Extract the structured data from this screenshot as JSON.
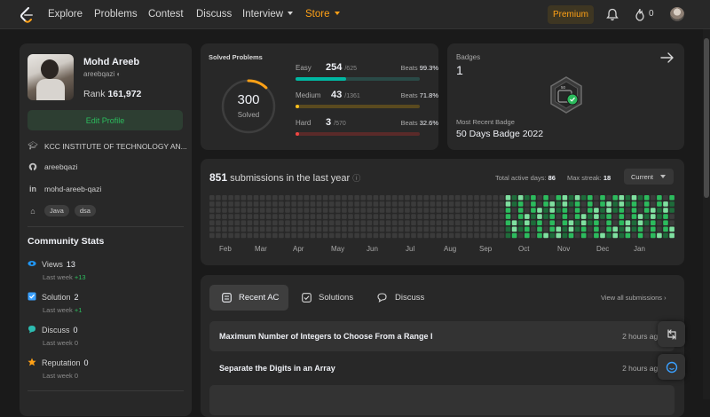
{
  "nav": {
    "items": [
      "Explore",
      "Problems",
      "Contest",
      "Discuss",
      "Interview",
      "Store"
    ],
    "premium": "Premium",
    "streak": "0"
  },
  "profile": {
    "name": "Mohd Areeb",
    "handle": "areebqazi",
    "rank_label": "Rank",
    "rank": "161,972",
    "edit_label": "Edit Profile",
    "institution": "KCC INSTITUTE OF TECHNOLOGY AN...",
    "github": "areebqazi",
    "linkedin": "mohd-areeb-qazi",
    "tags": [
      "Java",
      "dsa"
    ]
  },
  "community": {
    "title": "Community Stats",
    "stats": [
      {
        "label": "Views",
        "value": "13",
        "sub": "Last week",
        "delta": "+13",
        "color": "#2196f3"
      },
      {
        "label": "Solution",
        "value": "2",
        "sub": "Last week",
        "delta": "+1",
        "color": "#3aa0ff"
      },
      {
        "label": "Discuss",
        "value": "0",
        "sub": "Last week",
        "delta": "0",
        "color": "#2cbbb0"
      },
      {
        "label": "Reputation",
        "value": "0",
        "sub": "Last week",
        "delta": "0",
        "color": "#ffa116"
      }
    ]
  },
  "solved": {
    "title": "Solved Problems",
    "total": "300",
    "total_label": "Solved",
    "ring_fraction": 0.12,
    "difficulties": [
      {
        "label": "Easy",
        "count": "254",
        "total": "/625",
        "beats_label": "Beats",
        "beats": "99.3%",
        "fraction": 0.406,
        "color": "#00b8a3",
        "track": "#2a4a47"
      },
      {
        "label": "Medium",
        "count": "43",
        "total": "/1361",
        "beats_label": "Beats",
        "beats": "71.8%",
        "fraction": 0.032,
        "color": "#ffc01e",
        "track": "#5a4a1f"
      },
      {
        "label": "Hard",
        "count": "3",
        "total": "/570",
        "beats_label": "Beats",
        "beats": "32.6%",
        "fraction": 0.005,
        "color": "#ef4743",
        "track": "#5a2a29"
      }
    ]
  },
  "badges": {
    "title": "Badges",
    "count": "1",
    "recent_label": "Most Recent Badge",
    "recent_name": "50 Days Badge 2022",
    "badge_text": "50"
  },
  "submissions": {
    "count": "851",
    "label": "submissions in the last year",
    "active_label": "Total active days:",
    "active_days": "86",
    "streak_label": "Max streak:",
    "max_streak": "18",
    "select": "Current",
    "months": [
      "Feb",
      "Mar",
      "Apr",
      "May",
      "Jun",
      "Jul",
      "Aug",
      "Sep",
      "Oct",
      "Nov",
      "Dec",
      "Jan"
    ]
  },
  "recent": {
    "tabs": [
      "Recent AC",
      "Solutions",
      "Discuss"
    ],
    "view_all": "View all submissions",
    "rows": [
      {
        "title": "Maximum Number of Integers to Choose From a Range I",
        "time": "2 hours ago"
      },
      {
        "title": "Separate the Digits in an Array",
        "time": "2 hours ago"
      }
    ]
  }
}
